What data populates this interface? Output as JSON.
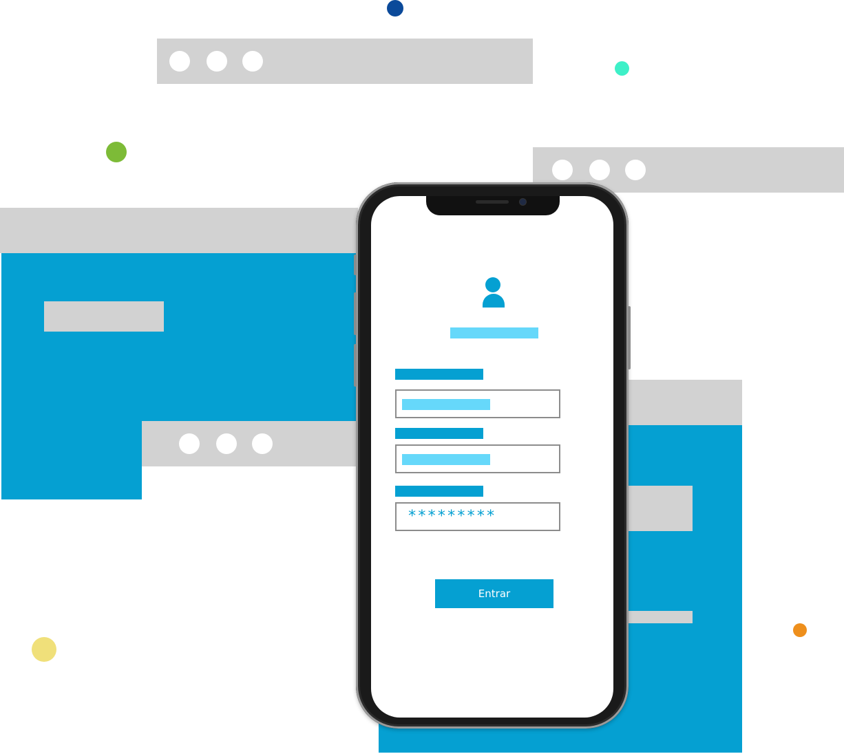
{
  "login": {
    "password_mask": "*********",
    "button_label": "Entrar"
  },
  "colors": {
    "primary_blue": "#05a0d2",
    "light_blue": "#66d8fa",
    "gray": "#d2d2d2",
    "dot_navy": "#0b4a9a",
    "dot_teal": "#3ef0c8",
    "dot_green": "#7dbb37",
    "dot_yellow": "#f0e07a",
    "dot_orange": "#ee8f1c"
  }
}
